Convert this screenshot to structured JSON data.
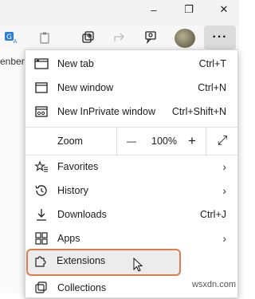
{
  "window": {
    "minimize_glyph": "–",
    "restore_glyph": "❐",
    "close_glyph": "✕"
  },
  "bookmarks_bar": {
    "partial_text": "enbery"
  },
  "more_button": {
    "glyph": "···"
  },
  "menu": {
    "new_tab": {
      "label": "New tab",
      "shortcut": "Ctrl+T"
    },
    "new_window": {
      "label": "New window",
      "shortcut": "Ctrl+N"
    },
    "new_inprivate": {
      "label": "New InPrivate window",
      "shortcut": "Ctrl+Shift+N"
    },
    "zoom": {
      "label": "Zoom",
      "minus": "—",
      "value": "100%",
      "plus": "+",
      "fullscreen_glyph": "⤢"
    },
    "favorites": {
      "label": "Favorites",
      "chevron": "›"
    },
    "history": {
      "label": "History",
      "chevron": "›"
    },
    "downloads": {
      "label": "Downloads",
      "shortcut": "Ctrl+J"
    },
    "apps": {
      "label": "Apps",
      "chevron": "›"
    },
    "extensions": {
      "label": "Extensions"
    },
    "collections": {
      "label": "Collections"
    }
  },
  "highlight_color": "#e07b4f",
  "watermark": "wsxdn.com"
}
